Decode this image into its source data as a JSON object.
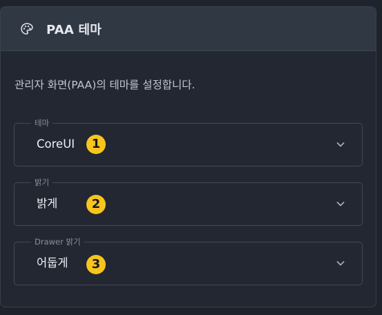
{
  "header": {
    "icon": "palette-icon",
    "title": "PAA 테마"
  },
  "description": "관리자 화면(PAA)의 테마를 설정합니다.",
  "fields": [
    {
      "legend": "테마",
      "value": "CoreUI",
      "badge": "1",
      "icon": "chevron-down-icon"
    },
    {
      "legend": "밝기",
      "value": "밝게",
      "badge": "2",
      "icon": "chevron-down-icon"
    },
    {
      "legend": "Drawer 밝기",
      "value": "어둡게",
      "badge": "3",
      "icon": "chevron-down-icon"
    }
  ],
  "colors": {
    "background": "#222731",
    "header": "#303844",
    "badge": "#f7c51d"
  }
}
